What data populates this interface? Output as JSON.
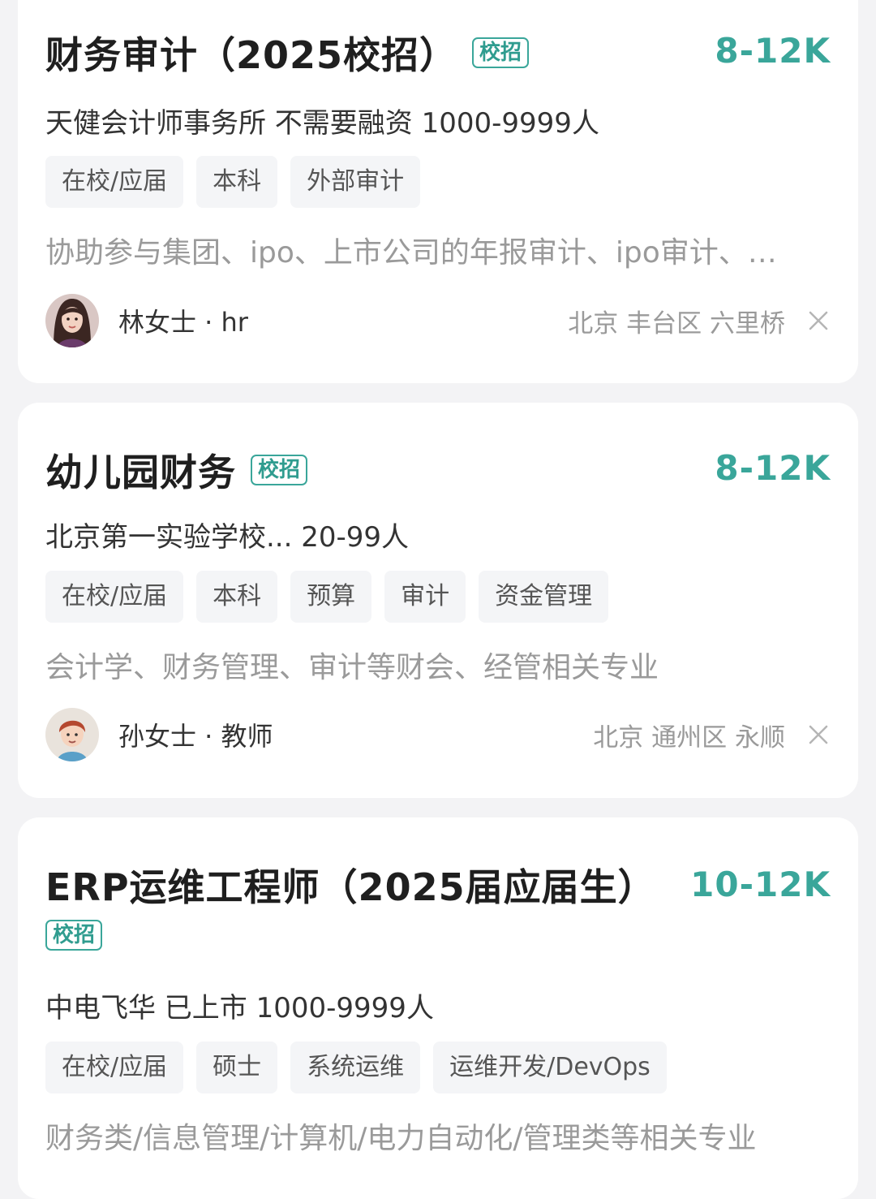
{
  "jobs": [
    {
      "title": "财务审计（2025校招）",
      "badge": "校招",
      "salary": "8-12K",
      "company": "天健会计师事务所 不需要融资 1000-9999人",
      "tags": [
        "在校/应届",
        "本科",
        "外部审计"
      ],
      "description": "协助参与集团、ipo、上市公司的年报审计、ipo审计、…",
      "recruiter": "林女士 · hr",
      "location": "北京 丰台区 六里桥",
      "avatar_icon": "woman-avatar-icon"
    },
    {
      "title": "幼儿园财务",
      "badge": "校招",
      "salary": "8-12K",
      "company": "北京第一实验学校... 20-99人",
      "tags": [
        "在校/应届",
        "本科",
        "预算",
        "审计",
        "资金管理"
      ],
      "description": "会计学、财务管理、审计等财会、经管相关专业",
      "recruiter": "孙女士 · 教师",
      "location": "北京 通州区 永顺",
      "avatar_icon": "cartoon-avatar-icon"
    },
    {
      "title": "ERP运维工程师（2025届应届生）",
      "badge": "校招",
      "salary": "10-12K",
      "company": "中电飞华 已上市 1000-9999人",
      "tags": [
        "在校/应届",
        "硕士",
        "系统运维",
        "运维开发/DevOps"
      ],
      "description": "财务类/信息管理/计算机/电力自动化/管理类等相关专业"
    }
  ],
  "colors": {
    "accent": "#3aa69a",
    "muted_text": "#9a9a9a",
    "tag_bg": "#f4f5f7"
  }
}
